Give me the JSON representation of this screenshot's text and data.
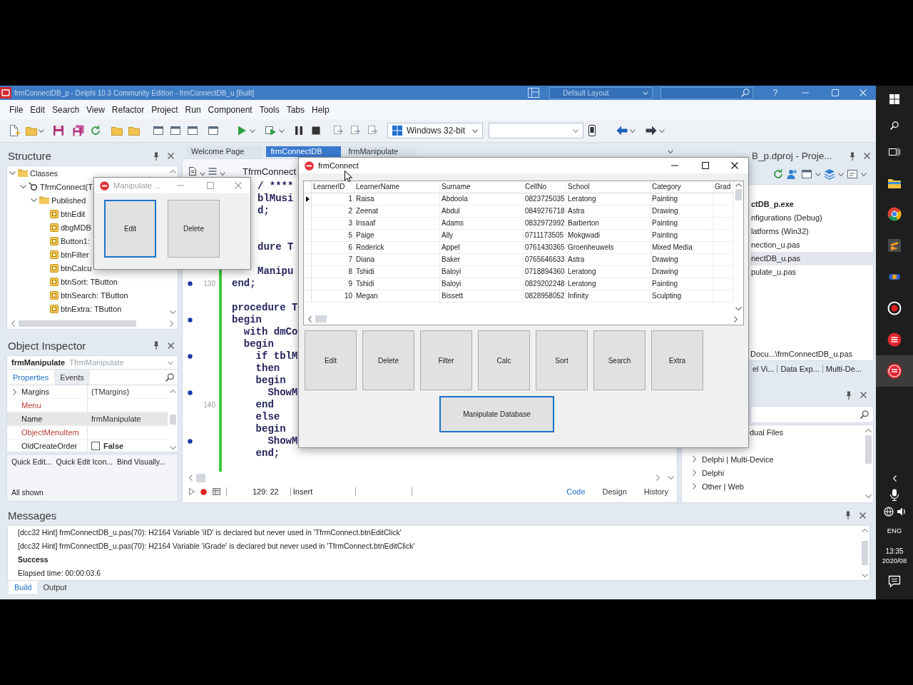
{
  "title_bar": {
    "title": "frmConnectDB_p - Delphi 10.3 Community Edition - frmConnectDB_u [Built]",
    "layout": "Default Layout",
    "help": "?"
  },
  "menu": [
    "File",
    "Edit",
    "Search",
    "View",
    "Refactor",
    "Project",
    "Run",
    "Component",
    "Tools",
    "Tabs",
    "Help"
  ],
  "toolbar": {
    "platform": "Windows 32-bit"
  },
  "structure": {
    "title": "Structure",
    "tree": [
      {
        "label": "Classes",
        "kind": "folder",
        "expanded": true,
        "children": [
          {
            "label": "TfrmConnect(T",
            "kind": "class",
            "expanded": true,
            "children": [
              {
                "label": "Published",
                "kind": "folder",
                "expanded": true,
                "children": [
                  {
                    "label": "btnEdit",
                    "kind": "component"
                  },
                  {
                    "label": "dbgMDB",
                    "kind": "component"
                  },
                  {
                    "label": "Button1:",
                    "kind": "component"
                  },
                  {
                    "label": "btnFilter",
                    "kind": "component"
                  },
                  {
                    "label": "btnCalcu",
                    "kind": "component"
                  },
                  {
                    "label": "btnSort: TButton",
                    "kind": "component"
                  },
                  {
                    "label": "btnSearch: TButton",
                    "kind": "component"
                  },
                  {
                    "label": "btnExtra: TButton",
                    "kind": "component"
                  }
                ]
              }
            ]
          }
        ]
      }
    ]
  },
  "object_inspector": {
    "title": "Object Inspector",
    "object": "frmManipulate",
    "object_type": "TfrmManipulate",
    "tabs": [
      {
        "label": "Properties",
        "selected": true
      },
      {
        "label": "Events",
        "selected": false
      }
    ],
    "properties": [
      {
        "name": "Margins",
        "value": "(TMargins)",
        "kind": "group",
        "selected": false
      },
      {
        "name": "Menu",
        "kind": "reference",
        "selected": false
      },
      {
        "name": "Name",
        "value": "frmManipulate",
        "kind": "text",
        "selected": true
      },
      {
        "name": "ObjectMenuItem",
        "kind": "reference",
        "selected": false
      },
      {
        "name": "OldCreateOrder",
        "value": "False",
        "kind": "boolean",
        "checked": false,
        "selected": false
      }
    ],
    "links": [
      "Quick Edit...",
      "Quick Edit Icon...",
      "Bind Visually..."
    ],
    "status": "All shown"
  },
  "editor": {
    "tabs": [
      {
        "label": "Welcome Page",
        "selected": false
      },
      {
        "label": "frmConnectDB",
        "selected": true
      },
      {
        "label": "frmManipulate",
        "selected": false
      }
    ],
    "class_selector": "TfrmConnect",
    "lines": [
      {
        "kind": "cut",
        "code": "/ ****"
      },
      {
        "kind": "cut",
        "code": "blMusi"
      },
      {
        "kind": "cut",
        "code": "d;"
      },
      {
        "kind": "blank"
      },
      {
        "kind": "blank"
      },
      {
        "kind": "cut",
        "code": "dure T"
      },
      {
        "kind": "blank"
      },
      {
        "kind": "cut",
        "code": "Manipu",
        "executable": false,
        "modified": true
      },
      {
        "kind": "code",
        "number": "130",
        "code": "end;",
        "executable": true,
        "modified": true
      },
      {
        "kind": "blank",
        "executable": false,
        "modified": true
      },
      {
        "kind": "code",
        "code": "procedure T",
        "executable": false,
        "modified": true
      },
      {
        "kind": "code",
        "code": "begin",
        "executable": true,
        "modified": true
      },
      {
        "kind": "code",
        "code": "  with dmCo",
        "executable": false,
        "modified": true
      },
      {
        "kind": "code",
        "code": "  begin",
        "executable": false,
        "modified": true
      },
      {
        "kind": "code",
        "code": "    if tblM",
        "executable": true,
        "modified": true
      },
      {
        "kind": "code",
        "code": "    then",
        "executable": false,
        "modified": true
      },
      {
        "kind": "code",
        "code": "    begin",
        "executable": false,
        "modified": true
      },
      {
        "kind": "code",
        "code": "      ShowM",
        "executable": true,
        "modified": true
      },
      {
        "kind": "code",
        "number": "140",
        "code": "    end",
        "executable": false,
        "modified": true
      },
      {
        "kind": "code",
        "code": "    else",
        "executable": false,
        "modified": true
      },
      {
        "kind": "code",
        "code": "    begin",
        "executable": false,
        "modified": true
      },
      {
        "kind": "code",
        "code": "      ShowM",
        "executable": true,
        "modified": true
      },
      {
        "kind": "code",
        "code": "    end;",
        "executable": false,
        "modified": true
      },
      {
        "kind": "blank",
        "executable": false,
        "modified": true
      }
    ],
    "position": "129: 22",
    "mode": "Insert",
    "view_tabs": [
      {
        "label": "Code",
        "selected": true
      },
      {
        "label": "Design",
        "selected": false
      },
      {
        "label": "History",
        "selected": false
      }
    ]
  },
  "project": {
    "title": "B_p.dproj - Proje...",
    "items": [
      {
        "label": "ctDB_p.exe",
        "kind": "project",
        "selected": false
      },
      {
        "label": "nfigurations (Debug)",
        "kind": "item",
        "selected": false
      },
      {
        "label": "latforms (Win32)",
        "kind": "item",
        "selected": false
      },
      {
        "label": "nection_u.pas",
        "kind": "item",
        "selected": false
      },
      {
        "label": "nectDB_u.pas",
        "kind": "item",
        "selected": true
      },
      {
        "label": "pulate_u.pas",
        "kind": "item",
        "selected": false
      }
    ],
    "path": "Docu...\\frmConnectDB_u.pas",
    "tabs": [
      {
        "label": "el Vi...",
        "selected": false
      },
      {
        "label": "Data Exp...",
        "selected": false
      },
      {
        "label": "Multi-De...",
        "selected": false
      }
    ]
  },
  "palette": {
    "items": [
      {
        "label": "dual Files",
        "kind": "cut"
      },
      {
        "label": "Delphi | Multi-Device",
        "kind": "category",
        "expanded": false
      },
      {
        "label": "Delphi",
        "kind": "category",
        "expanded": false
      },
      {
        "label": "Other | Web",
        "kind": "category",
        "expanded": false
      }
    ]
  },
  "messages": {
    "title": "Messages",
    "lines": [
      {
        "text": "[dcc32 Hint] frmConnectDB_u.pas(70): H2164 Variable 'iID' is declared but never used in 'TfrmConnect.btnEditClick'",
        "kind": "text"
      },
      {
        "text": "[dcc32 Hint] frmConnectDB_u.pas(70): H2164 Variable 'iGrade' is declared but never used in 'TfrmConnect.btnEditClick'",
        "kind": "text"
      },
      {
        "text": "Success",
        "kind": "heading"
      },
      {
        "text": "Elapsed time: 00:00:03.6",
        "kind": "text"
      }
    ],
    "tabs": [
      {
        "label": "Build",
        "selected": true
      },
      {
        "label": "Output",
        "selected": false
      }
    ]
  },
  "manipulate_window": {
    "title": "Manipulate ...",
    "active": false,
    "buttons": [
      {
        "label": "Edit",
        "focused": true
      },
      {
        "label": "Delete",
        "focused": false
      }
    ]
  },
  "connect_window": {
    "title": "frmConnect",
    "active": true,
    "grid": {
      "columns": [
        "LearnerID",
        "LearnerName",
        "Surname",
        "CellNo",
        "School",
        "Category",
        "Grad"
      ],
      "rows": [
        {
          "selected": true,
          "cells": [
            "1",
            "Raisa",
            "Abdoola",
            "0823725035",
            "Leratong",
            "Painting"
          ]
        },
        {
          "selected": false,
          "cells": [
            "2",
            "Zeenat",
            "Abdul",
            "0849276718",
            "Astra",
            "Drawing"
          ]
        },
        {
          "selected": false,
          "cells": [
            "3",
            "Insaaf",
            "Adams",
            "0832972992",
            "Barberton",
            "Painting"
          ]
        },
        {
          "selected": false,
          "cells": [
            "5",
            "Paige",
            "Ally",
            "0711173505",
            "Mokgwadi",
            "Painting"
          ]
        },
        {
          "selected": false,
          "cells": [
            "6",
            "Roderick",
            "Appel",
            "0761430365",
            "Groenheuwels",
            "Mixed Media"
          ]
        },
        {
          "selected": false,
          "cells": [
            "7",
            "Diana",
            "Baker",
            "0765646633",
            "Astra",
            "Drawing"
          ]
        },
        {
          "selected": false,
          "cells": [
            "8",
            "Tshidi",
            "Baloyi",
            "0718894360",
            "Leratong",
            "Drawing"
          ]
        },
        {
          "selected": false,
          "cells": [
            "9",
            "Tshidi",
            "Baloyi",
            "0829202248",
            "Leratong",
            "Painting"
          ]
        },
        {
          "selected": false,
          "cells": [
            "10",
            "Megan",
            "Bissett",
            "0828958052",
            "Infinity",
            "Sculpting"
          ]
        }
      ]
    },
    "buttons": [
      {
        "label": "Edit",
        "focused": false
      },
      {
        "label": "Delete",
        "focused": false
      },
      {
        "label": "Filter",
        "focused": false
      },
      {
        "label": "Calc",
        "focused": false
      },
      {
        "label": "Sort",
        "focused": false
      },
      {
        "label": "Search",
        "focused": false
      },
      {
        "label": "Extra",
        "focused": false
      }
    ],
    "main_button": {
      "label": "Manipulate Database",
      "focused": true
    }
  },
  "taskbar": {
    "apps": [
      {
        "selected": false
      },
      {
        "selected": false
      },
      {
        "selected": false
      },
      {
        "selected": false
      },
      {
        "selected": false
      },
      {
        "selected": false
      },
      {
        "selected": true
      }
    ],
    "language": "ENG",
    "time": "13:35",
    "date": "2020/08"
  }
}
